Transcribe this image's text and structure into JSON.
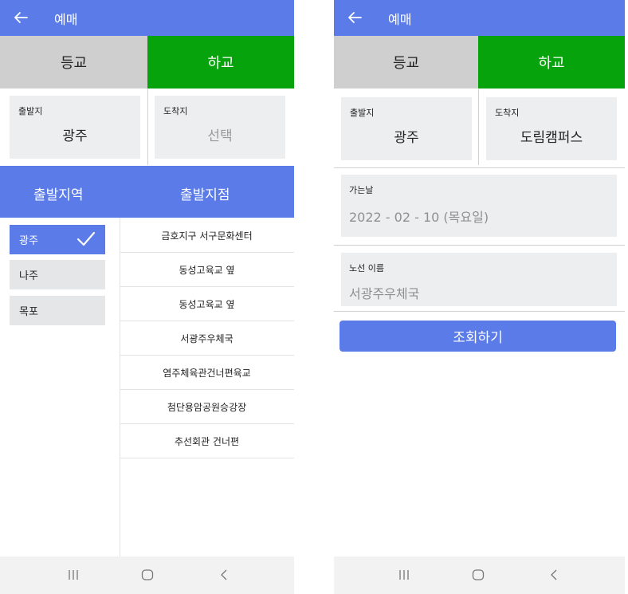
{
  "left": {
    "header": {
      "title": "예매"
    },
    "tabs": [
      {
        "label": "등교",
        "active": false
      },
      {
        "label": "하교",
        "active": true
      }
    ],
    "departure": {
      "label": "출발지",
      "value": "광주"
    },
    "arrival": {
      "label": "도착지",
      "value": "선택"
    },
    "picker": {
      "region_header": "출발지역",
      "stop_header": "출발지점",
      "regions": [
        {
          "label": "광주",
          "selected": true
        },
        {
          "label": "나주",
          "selected": false
        },
        {
          "label": "목포",
          "selected": false
        }
      ],
      "stops": [
        "금호지구 서구문화센터",
        "동성고육교 옆",
        "동성고육교 옆",
        "서광주우체국",
        "염주체육관건너편육교",
        "첨단용암공원승강장",
        "추선회관 건너편"
      ]
    }
  },
  "right": {
    "header": {
      "title": "예매"
    },
    "tabs": [
      {
        "label": "등교",
        "active": false
      },
      {
        "label": "하교",
        "active": true
      }
    ],
    "departure": {
      "label": "출발지",
      "value": "광주"
    },
    "arrival": {
      "label": "도착지",
      "value": "도림캠퍼스"
    },
    "date": {
      "label": "가는날",
      "value": "2022 - 02 - 10 (목요일)"
    },
    "route": {
      "label": "노선 이름",
      "value": "서광주우체국"
    },
    "search_button": "조회하기"
  },
  "colors": {
    "primary": "#5b7ce8",
    "active_tab": "#07a30d",
    "inactive_tab": "#cfcfcf",
    "field_bg": "#edeef0"
  },
  "icons": {
    "back": "arrow-left-icon",
    "check": "check-icon",
    "nav_recents": "recents-icon",
    "nav_home": "home-icon",
    "nav_back": "chevron-left-icon"
  }
}
